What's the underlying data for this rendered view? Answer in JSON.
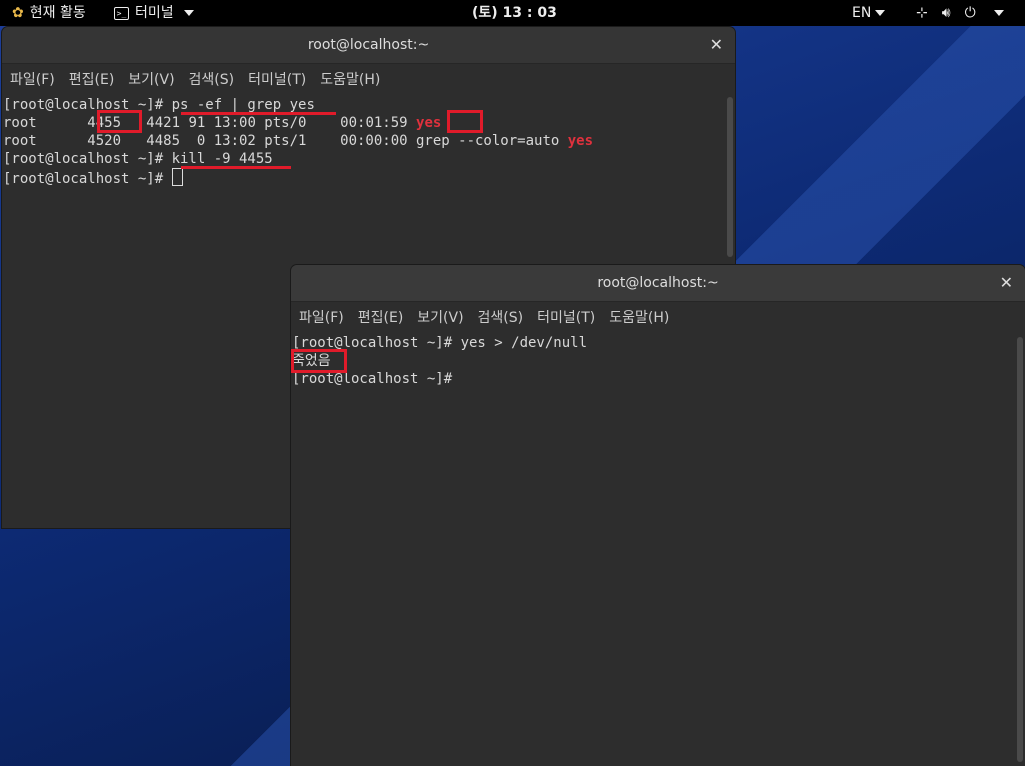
{
  "topbar": {
    "activities": "현재 활동",
    "app_menu": "터미널",
    "clock": "(토) 13 : 03",
    "lang": "EN",
    "icons": [
      "network-icon",
      "volume-icon",
      "power-icon"
    ]
  },
  "windows": [
    {
      "title": "root@localhost:~",
      "menu": [
        "파일(F)",
        "편집(E)",
        "보기(V)",
        "검색(S)",
        "터미널(T)",
        "도움말(H)"
      ],
      "lines": {
        "l1_prompt": "[root@localhost ~]# ",
        "l1_cmd": "ps -ef | grep yes",
        "l2_a": "root      ",
        "l2_pid": "4455",
        "l2_b": "   4421 91 13:00 pts/0    00:01:59 ",
        "l2_yes": "yes",
        "l3_a": "root      4520   4485  0 13:02 pts/1    00:00:00 grep --color=auto ",
        "l3_yes": "yes",
        "l4_prompt": "[root@localhost ~]# ",
        "l4_cmd": "kill -9 4455",
        "l5_prompt": "[root@localhost ~]# "
      }
    },
    {
      "title": "root@localhost:~",
      "menu": [
        "파일(F)",
        "편집(E)",
        "보기(V)",
        "검색(S)",
        "터미널(T)",
        "도움말(H)"
      ],
      "lines": {
        "l1": "[root@localhost ~]# yes > /dev/null",
        "l2": "죽었음",
        "l3": "[root@localhost ~]# "
      }
    }
  ],
  "colors": {
    "annotation": "#e01b2a",
    "highlight": "#e0313d"
  }
}
